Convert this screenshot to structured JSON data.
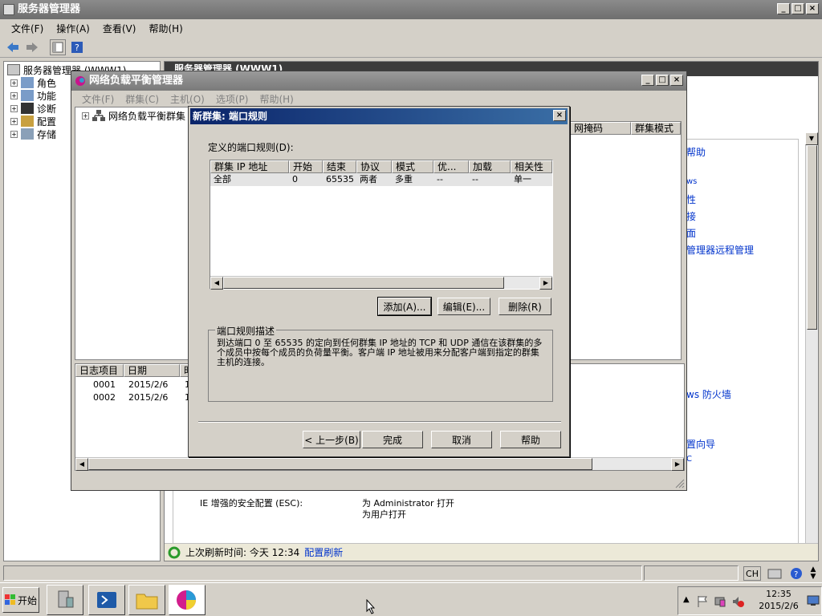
{
  "app": {
    "title": "服务器管理器",
    "menu": [
      "文件(F)",
      "操作(A)",
      "查看(V)",
      "帮助(H)"
    ]
  },
  "tree": {
    "header": "服务器管理器 (WWW1)",
    "items": [
      "角色",
      "功能",
      "诊断",
      "配置",
      "存储"
    ]
  },
  "main": {
    "header": "服务器管理器 (WWW1)",
    "right_links": [
      "帮助",
      "ws",
      "性",
      "接",
      "面",
      "管理器远程管理",
      "ws 防火墙",
      "置向导",
      "C"
    ],
    "esc_label": "IE 增强的安全配置 (ESC):",
    "esc_admin": "为 Administrator 打开",
    "esc_users": "为用户打开",
    "refresh_text": "上次刷新时间: 今天 12:34",
    "refresh_link": "配置刷新"
  },
  "nlb": {
    "title": "网络负载平衡管理器",
    "menu": [
      "文件(F)",
      "群集(C)",
      "主机(O)",
      "选项(P)",
      "帮助(H)"
    ],
    "tree_item": "网络负载平衡群集",
    "right_headers": [
      "网掩码",
      "群集模式"
    ],
    "log_headers": [
      "日志项目",
      "日期",
      "时"
    ],
    "log_rows": [
      {
        "id": "0001",
        "date": "2015/2/6",
        "time": "1"
      },
      {
        "id": "0002",
        "date": "2015/2/6",
        "time": "1"
      }
    ]
  },
  "dialog": {
    "title": "新群集: 端口规则",
    "rules_label": "定义的端口规则(D):",
    "columns": [
      "群集 IP 地址",
      "开始",
      "结束",
      "协议",
      "模式",
      "优...",
      "加载",
      "相关性"
    ],
    "rows": [
      [
        "全部",
        "0",
        "65535",
        "两者",
        "多重",
        "--",
        "--",
        "单一"
      ]
    ],
    "add": "添加(A)...",
    "edit": "编辑(E)...",
    "remove": "删除(R)",
    "desc_label": "端口规则描述",
    "desc_text": "到达端口 0 至 65535 的定向到任何群集 IP 地址的 TCP 和 UDP 通信在该群集的多个成员中按每个成员的负荷量平衡。客户端 IP 地址被用来分配客户端到指定的群集主机的连接。",
    "back": "< 上一步(B)",
    "finish": "完成",
    "cancel": "取消",
    "help": "帮助"
  },
  "statusbar": {
    "lang": "CH"
  },
  "taskbar": {
    "start": "开始",
    "time": "12:35",
    "date": "2015/2/6"
  },
  "colors": {
    "dialog_title": "#0a246a",
    "link": "#0033cc",
    "face": "#d4d0c8"
  }
}
